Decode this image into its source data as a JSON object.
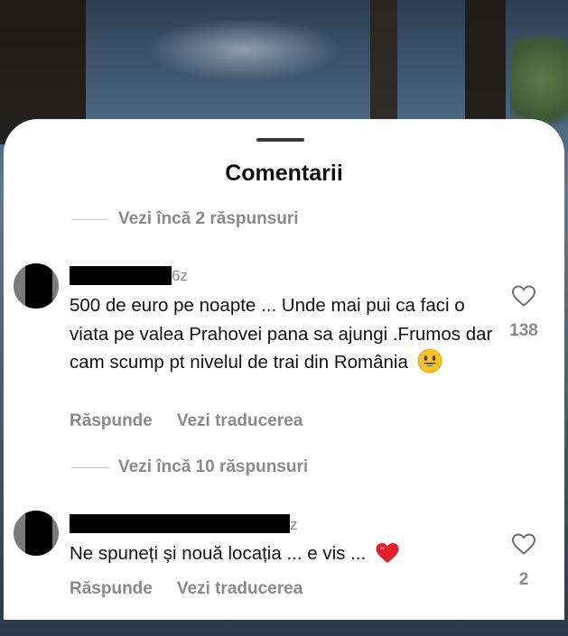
{
  "sheet": {
    "title": "Comentarii"
  },
  "thread1": {
    "more_replies": "Vezi încă 2 răspunsuri"
  },
  "comment1": {
    "age": "6z",
    "text": "500 de euro pe noapte ... Unde mai pui ca faci o viata pe valea Prahovei pana sa ajungi .Frumos dar cam scump pt nivelul de trai din România",
    "emoji": "smiling-face",
    "likes": "138",
    "reply_label": "Răspunde",
    "translate_label": "Vezi traducerea"
  },
  "thread2": {
    "more_replies": "Vezi încă 10 răspunsuri"
  },
  "comment2": {
    "age": "z",
    "text": "Ne spuneți și nouă locația ... e vis ...",
    "emoji": "red-heart",
    "likes": "2",
    "reply_label": "Răspunde",
    "translate_label": "Vezi traducerea"
  },
  "icons": {
    "like": "heart-outline-icon",
    "handle": "drag-handle"
  },
  "colors": {
    "muted_text": "#8a8a8a",
    "primary_text": "#111111",
    "sheet_bg": "#ffffff"
  }
}
